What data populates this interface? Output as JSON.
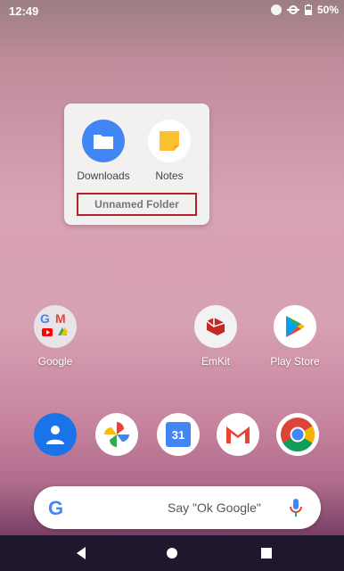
{
  "status": {
    "time": "12:49",
    "battery": "50%"
  },
  "folder": {
    "apps": [
      {
        "label": "Downloads",
        "icon": "downloads-icon"
      },
      {
        "label": "Notes",
        "icon": "notes-icon"
      }
    ],
    "name": "Unnamed Folder"
  },
  "home_apps": [
    {
      "label": "Google",
      "icon": "google-folder-icon"
    },
    {
      "label": "EmKit",
      "icon": "emkit-icon"
    },
    {
      "label": "Play Store",
      "icon": "play-store-icon"
    }
  ],
  "dock": [
    "contacts-icon",
    "photos-icon",
    "calendar-icon",
    "gmail-icon",
    "chrome-icon"
  ],
  "calendar_day": "31",
  "search": {
    "hint": "Say \"Ok Google\""
  },
  "colors": {
    "folder_highlight": "#b5212a",
    "accent_blue": "#4285f4"
  }
}
